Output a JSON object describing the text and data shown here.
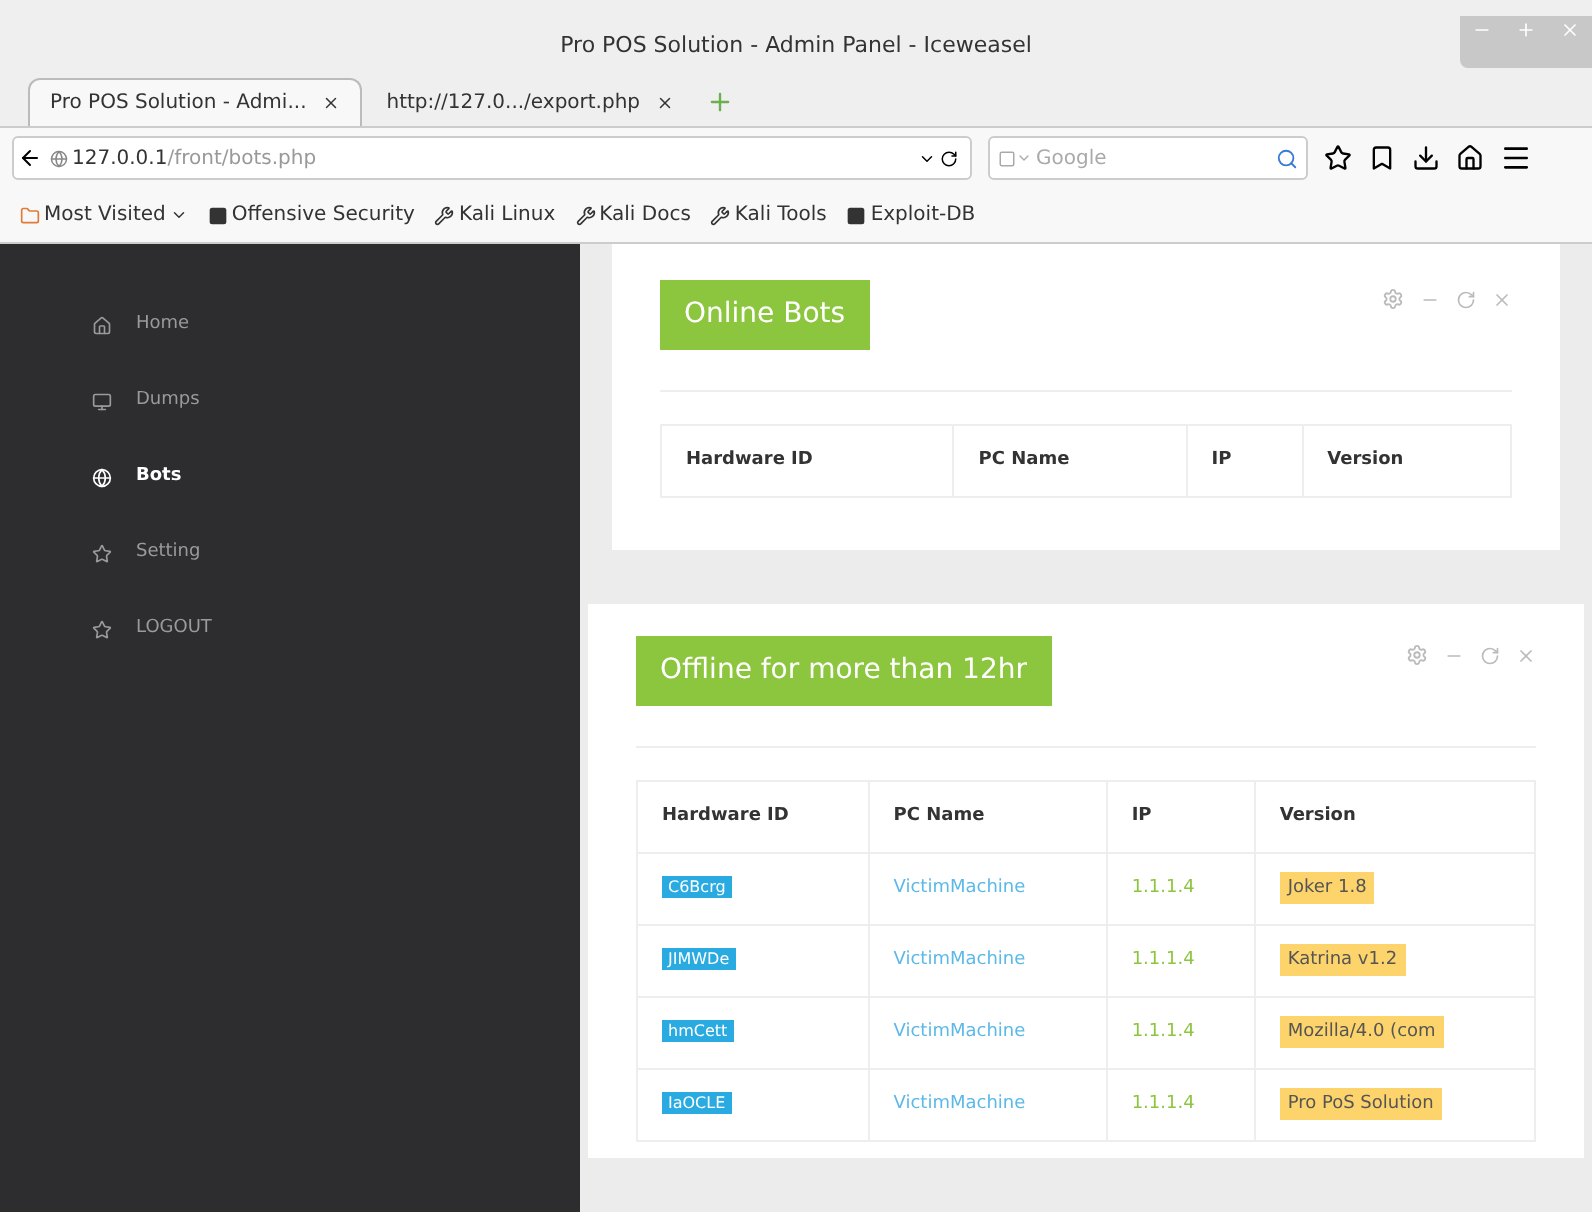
{
  "window": {
    "title": "Pro POS Solution - Admin Panel - Iceweasel"
  },
  "tabs": [
    {
      "label": "Pro POS Solution - Admi...",
      "selected": true
    },
    {
      "label": "http://127.0.../export.php",
      "selected": false
    }
  ],
  "address_bar": {
    "host": "127.0.0.1",
    "path": "/front/bots.php"
  },
  "search": {
    "placeholder": "Google"
  },
  "bookmarks": [
    "Most Visited",
    "Offensive Security",
    "Kali Linux",
    "Kali Docs",
    "Kali Tools",
    "Exploit-DB"
  ],
  "sidebar": {
    "items": [
      {
        "label": "Home",
        "selected": false
      },
      {
        "label": "Dumps",
        "selected": false
      },
      {
        "label": "Bots",
        "selected": true
      },
      {
        "label": "Setting",
        "selected": false
      },
      {
        "label": "LOGOUT",
        "selected": false
      }
    ]
  },
  "panels": [
    {
      "title": "Online Bots",
      "columns": [
        "Hardware ID",
        "PC Name",
        "IP",
        "Version"
      ]
    },
    {
      "title": "Offline for more than 12hr",
      "columns": [
        "Hardware ID",
        "PC Name",
        "IP",
        "Version"
      ],
      "rows": [
        {
          "hardware_id": "C6Bcrg",
          "pc_name": "VictimMachine",
          "ip": "1.1.1.4",
          "version": "Joker 1.8"
        },
        {
          "hardware_id": "JIMWDe",
          "pc_name": "VictimMachine",
          "ip": "1.1.1.4",
          "version": "Katrina v1.2"
        },
        {
          "hardware_id": "hmCett",
          "pc_name": "VictimMachine",
          "ip": "1.1.1.4",
          "version": "Mozilla/4.0 (com"
        },
        {
          "hardware_id": "IaOCLE",
          "pc_name": "VictimMachine",
          "ip": "1.1.1.4",
          "version": "Pro PoS Solution"
        }
      ]
    }
  ]
}
